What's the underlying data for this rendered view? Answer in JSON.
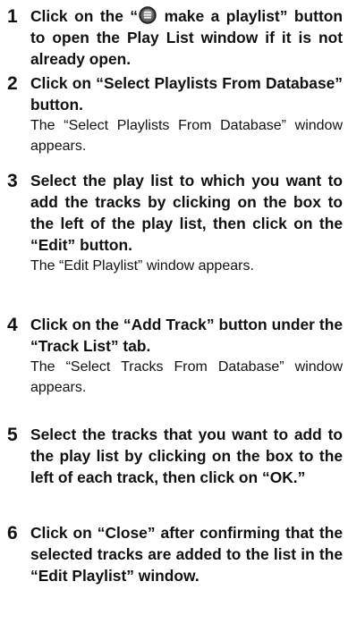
{
  "steps": [
    {
      "number": "1",
      "instruction_before_icon": "Click on the “",
      "icon": "playlist-icon",
      "instruction_after_icon": " make a playlist” button to open the Play List window if it is not already open.",
      "note": ""
    },
    {
      "number": "2",
      "instruction": "Click on “Select Playlists From Database” button.",
      "note": "The “Select Playlists From Database” window appears."
    },
    {
      "number": "3",
      "instruction": "Select the play list to which you want to add the tracks by clicking on the box to the left of the play list, then click on the “Edit” button.",
      "note": "The “Edit Playlist” window appears."
    },
    {
      "number": "4",
      "instruction": "Click on the “Add Track” button under the “Track List” tab.",
      "note": "The “Select Tracks From Database” window appears."
    },
    {
      "number": "5",
      "instruction": "Select the tracks that you want to add to the play list by clicking on the box to the left of each track, then click on “OK.”",
      "note": ""
    },
    {
      "number": "6",
      "instruction": "Click on “Close” after confirming that the selected tracks are added to the list in the “Edit Playlist” window.",
      "note": ""
    }
  ]
}
